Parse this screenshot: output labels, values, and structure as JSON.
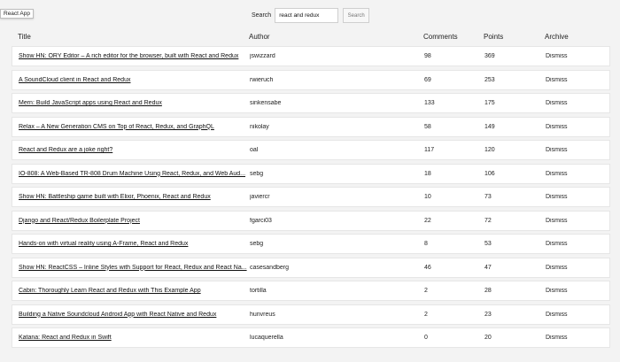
{
  "tooltip": "React App",
  "search": {
    "label": "Search",
    "value": "react and redux",
    "button": "Search"
  },
  "columns": {
    "title": "Title",
    "author": "Author",
    "comments": "Comments",
    "points": "Points",
    "archive": "Archive"
  },
  "rows": [
    {
      "title": "Show HN: ORY Editor – A rich editor for the browser, built with React and Redux",
      "author": "jswizzard",
      "comments": "98",
      "points": "369",
      "action": "Dismiss"
    },
    {
      "title": "A SoundCloud client in React and Redux",
      "author": "rwieruch",
      "comments": "69",
      "points": "253",
      "action": "Dismiss"
    },
    {
      "title": "Mern: Build JavaScript apps using React and Redux",
      "author": "sinkensabe",
      "comments": "133",
      "points": "175",
      "action": "Dismiss"
    },
    {
      "title": "Relax – A New Generation CMS on Top of React, Redux, and GraphQL",
      "author": "nikolay",
      "comments": "58",
      "points": "149",
      "action": "Dismiss"
    },
    {
      "title": "React and Redux are a joke right?",
      "author": "oal",
      "comments": "117",
      "points": "120",
      "action": "Dismiss"
    },
    {
      "title": "IO-808: A Web-Based TR-808 Drum Machine Using React, Redux, and Web Aud...",
      "author": "sebg",
      "comments": "18",
      "points": "106",
      "action": "Dismiss"
    },
    {
      "title": "Show HN: Battleship game built with Elixir, Phoenix, React and Redux",
      "author": "javiercr",
      "comments": "10",
      "points": "73",
      "action": "Dismiss"
    },
    {
      "title": "Django and React/Redux Boilerplate Project",
      "author": "fgarci03",
      "comments": "22",
      "points": "72",
      "action": "Dismiss"
    },
    {
      "title": "Hands-on with virtual reality using A-Frame, React and Redux",
      "author": "sebg",
      "comments": "8",
      "points": "53",
      "action": "Dismiss"
    },
    {
      "title": "Show HN: ReactCSS – Inline Styles with Support for React, Redux and React Na...",
      "author": "casesandberg",
      "comments": "46",
      "points": "47",
      "action": "Dismiss"
    },
    {
      "title": "Cabin: Thoroughly Learn React and Redux with This Example App",
      "author": "tortilla",
      "comments": "2",
      "points": "28",
      "action": "Dismiss"
    },
    {
      "title": "Building a Native Soundcloud Android App with React Native and Redux",
      "author": "hunvreus",
      "comments": "2",
      "points": "23",
      "action": "Dismiss"
    },
    {
      "title": "Katana: React and Redux in Swift",
      "author": "lucaquerella",
      "comments": "0",
      "points": "20",
      "action": "Dismiss"
    }
  ]
}
